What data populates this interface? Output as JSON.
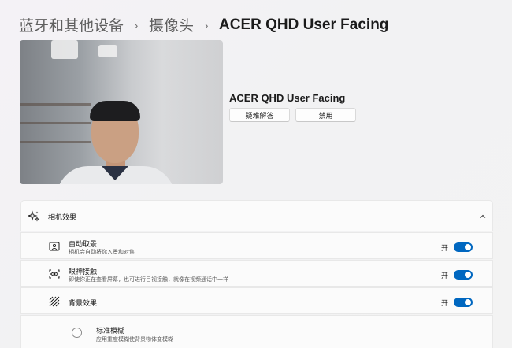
{
  "breadcrumb": {
    "items": [
      "蓝牙和其他设备",
      "摄像头",
      "ACER QHD User Facing"
    ]
  },
  "device": {
    "name": "ACER QHD User Facing",
    "troubleshoot_label": "疑难解答",
    "disable_label": "禁用"
  },
  "effects": {
    "header": {
      "title": "相机效果",
      "icon": "sparkle-icon",
      "expanded": true
    },
    "auto_framing": {
      "icon": "auto-framing-icon",
      "title": "自动取景",
      "description": "相机会自动将你入景和对焦",
      "state": "开",
      "on": true
    },
    "eye_contact": {
      "icon": "eye-contact-icon",
      "title": "眼神接触",
      "description": "即使你正在查看屏幕，也可进行目视接触，就像在视频通话中一样",
      "state": "开",
      "on": true
    },
    "background": {
      "icon": "background-effects-icon",
      "title": "背景效果",
      "state": "开",
      "on": true
    },
    "standard_blur": {
      "title": "标准模糊",
      "description": "应用重度模糊使背景物体变模糊",
      "selected": false
    }
  },
  "colors": {
    "accent": "#0067c0",
    "card": "#fbfbfb",
    "border": "#e8e8e8"
  }
}
